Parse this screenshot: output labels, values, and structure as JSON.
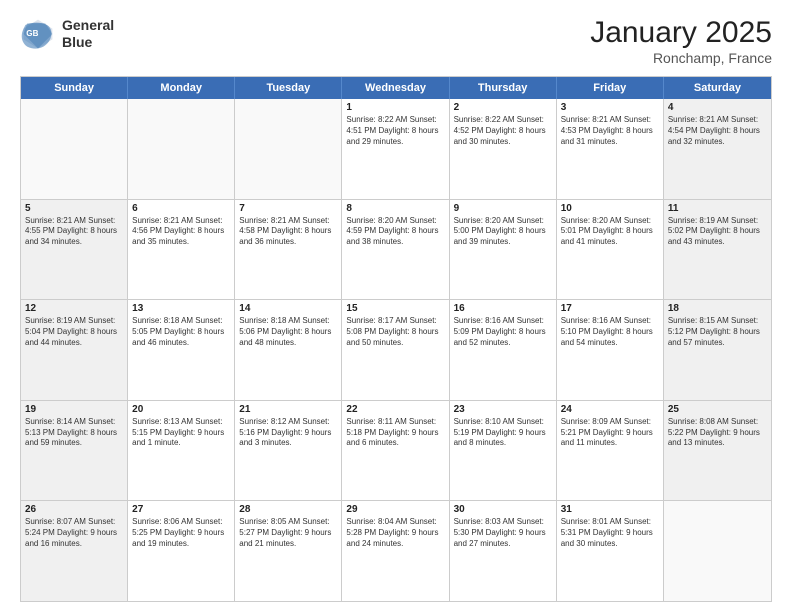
{
  "header": {
    "logo_line1": "General",
    "logo_line2": "Blue",
    "title": "January 2025",
    "subtitle": "Ronchamp, France"
  },
  "weekdays": [
    "Sunday",
    "Monday",
    "Tuesday",
    "Wednesday",
    "Thursday",
    "Friday",
    "Saturday"
  ],
  "rows": [
    [
      {
        "day": "",
        "text": "",
        "empty": true
      },
      {
        "day": "",
        "text": "",
        "empty": true
      },
      {
        "day": "",
        "text": "",
        "empty": true
      },
      {
        "day": "1",
        "text": "Sunrise: 8:22 AM\nSunset: 4:51 PM\nDaylight: 8 hours\nand 29 minutes."
      },
      {
        "day": "2",
        "text": "Sunrise: 8:22 AM\nSunset: 4:52 PM\nDaylight: 8 hours\nand 30 minutes."
      },
      {
        "day": "3",
        "text": "Sunrise: 8:21 AM\nSunset: 4:53 PM\nDaylight: 8 hours\nand 31 minutes."
      },
      {
        "day": "4",
        "text": "Sunrise: 8:21 AM\nSunset: 4:54 PM\nDaylight: 8 hours\nand 32 minutes.",
        "shaded": true
      }
    ],
    [
      {
        "day": "5",
        "text": "Sunrise: 8:21 AM\nSunset: 4:55 PM\nDaylight: 8 hours\nand 34 minutes.",
        "shaded": true
      },
      {
        "day": "6",
        "text": "Sunrise: 8:21 AM\nSunset: 4:56 PM\nDaylight: 8 hours\nand 35 minutes."
      },
      {
        "day": "7",
        "text": "Sunrise: 8:21 AM\nSunset: 4:58 PM\nDaylight: 8 hours\nand 36 minutes."
      },
      {
        "day": "8",
        "text": "Sunrise: 8:20 AM\nSunset: 4:59 PM\nDaylight: 8 hours\nand 38 minutes."
      },
      {
        "day": "9",
        "text": "Sunrise: 8:20 AM\nSunset: 5:00 PM\nDaylight: 8 hours\nand 39 minutes."
      },
      {
        "day": "10",
        "text": "Sunrise: 8:20 AM\nSunset: 5:01 PM\nDaylight: 8 hours\nand 41 minutes."
      },
      {
        "day": "11",
        "text": "Sunrise: 8:19 AM\nSunset: 5:02 PM\nDaylight: 8 hours\nand 43 minutes.",
        "shaded": true
      }
    ],
    [
      {
        "day": "12",
        "text": "Sunrise: 8:19 AM\nSunset: 5:04 PM\nDaylight: 8 hours\nand 44 minutes.",
        "shaded": true
      },
      {
        "day": "13",
        "text": "Sunrise: 8:18 AM\nSunset: 5:05 PM\nDaylight: 8 hours\nand 46 minutes."
      },
      {
        "day": "14",
        "text": "Sunrise: 8:18 AM\nSunset: 5:06 PM\nDaylight: 8 hours\nand 48 minutes."
      },
      {
        "day": "15",
        "text": "Sunrise: 8:17 AM\nSunset: 5:08 PM\nDaylight: 8 hours\nand 50 minutes."
      },
      {
        "day": "16",
        "text": "Sunrise: 8:16 AM\nSunset: 5:09 PM\nDaylight: 8 hours\nand 52 minutes."
      },
      {
        "day": "17",
        "text": "Sunrise: 8:16 AM\nSunset: 5:10 PM\nDaylight: 8 hours\nand 54 minutes."
      },
      {
        "day": "18",
        "text": "Sunrise: 8:15 AM\nSunset: 5:12 PM\nDaylight: 8 hours\nand 57 minutes.",
        "shaded": true
      }
    ],
    [
      {
        "day": "19",
        "text": "Sunrise: 8:14 AM\nSunset: 5:13 PM\nDaylight: 8 hours\nand 59 minutes.",
        "shaded": true
      },
      {
        "day": "20",
        "text": "Sunrise: 8:13 AM\nSunset: 5:15 PM\nDaylight: 9 hours\nand 1 minute."
      },
      {
        "day": "21",
        "text": "Sunrise: 8:12 AM\nSunset: 5:16 PM\nDaylight: 9 hours\nand 3 minutes."
      },
      {
        "day": "22",
        "text": "Sunrise: 8:11 AM\nSunset: 5:18 PM\nDaylight: 9 hours\nand 6 minutes."
      },
      {
        "day": "23",
        "text": "Sunrise: 8:10 AM\nSunset: 5:19 PM\nDaylight: 9 hours\nand 8 minutes."
      },
      {
        "day": "24",
        "text": "Sunrise: 8:09 AM\nSunset: 5:21 PM\nDaylight: 9 hours\nand 11 minutes."
      },
      {
        "day": "25",
        "text": "Sunrise: 8:08 AM\nSunset: 5:22 PM\nDaylight: 9 hours\nand 13 minutes.",
        "shaded": true
      }
    ],
    [
      {
        "day": "26",
        "text": "Sunrise: 8:07 AM\nSunset: 5:24 PM\nDaylight: 9 hours\nand 16 minutes.",
        "shaded": true
      },
      {
        "day": "27",
        "text": "Sunrise: 8:06 AM\nSunset: 5:25 PM\nDaylight: 9 hours\nand 19 minutes."
      },
      {
        "day": "28",
        "text": "Sunrise: 8:05 AM\nSunset: 5:27 PM\nDaylight: 9 hours\nand 21 minutes."
      },
      {
        "day": "29",
        "text": "Sunrise: 8:04 AM\nSunset: 5:28 PM\nDaylight: 9 hours\nand 24 minutes."
      },
      {
        "day": "30",
        "text": "Sunrise: 8:03 AM\nSunset: 5:30 PM\nDaylight: 9 hours\nand 27 minutes."
      },
      {
        "day": "31",
        "text": "Sunrise: 8:01 AM\nSunset: 5:31 PM\nDaylight: 9 hours\nand 30 minutes."
      },
      {
        "day": "",
        "text": "",
        "empty": true
      }
    ]
  ]
}
